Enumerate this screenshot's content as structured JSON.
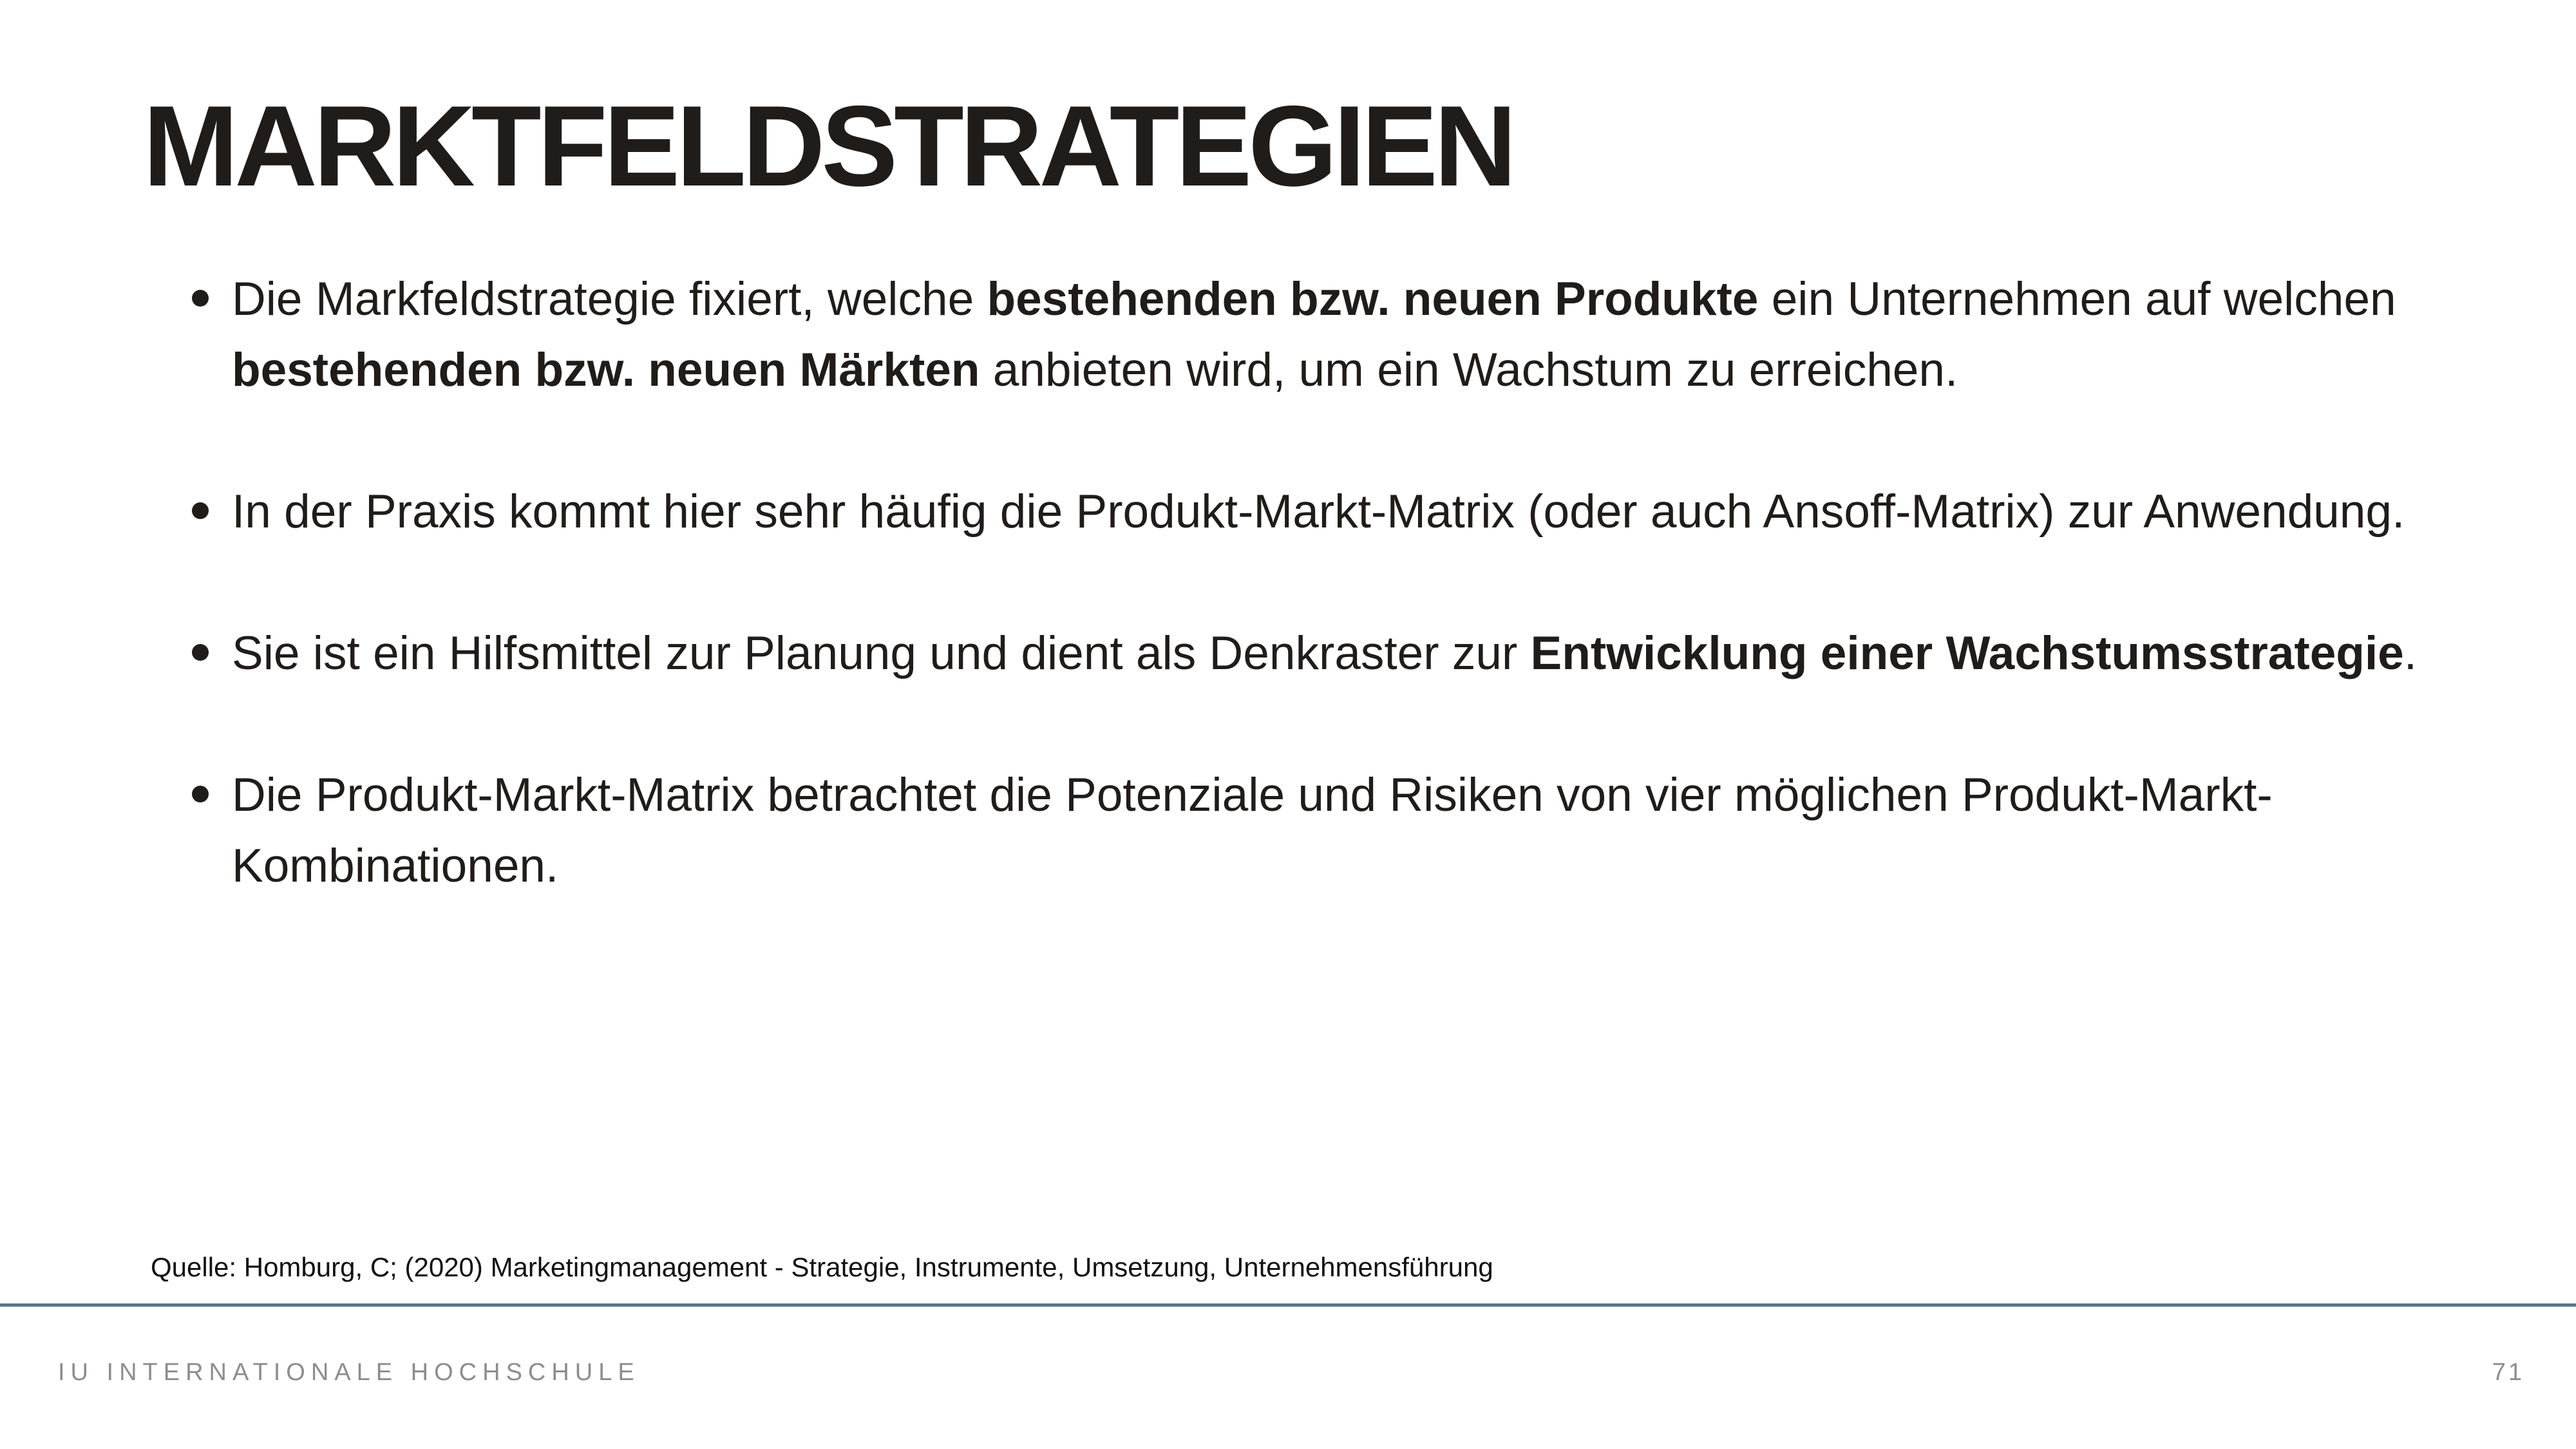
{
  "slide": {
    "title": "MARKTFELDSTRATEGIEN"
  },
  "bullets": [
    {
      "pre": "Die Markfeldstrategie fixiert, welche ",
      "bold1": "bestehenden bzw. neuen Produkte",
      "mid": " ein Unternehmen auf welchen ",
      "bold2": "bestehenden bzw. neuen Märkten",
      "post": " anbieten wird, um ein Wachstum zu erreichen."
    },
    {
      "text": "In der Praxis kommt hier sehr häufig die Produkt-Markt-Matrix (oder auch Ansoff-Matrix) zur Anwendung."
    },
    {
      "pre": "Sie ist ein Hilfsmittel zur Planung und dient als Denkraster zur ",
      "bold": "Entwicklung einer Wachstumsstrategie",
      "post": "."
    },
    {
      "text": "Die Produkt-Markt-Matrix betrachtet die Potenziale und Risiken von vier möglichen Produkt-Markt-Kombinationen."
    }
  ],
  "source": {
    "text": "Quelle: Homburg, C; (2020) Marketingmanagement - Strategie, Instrumente, Umsetzung, Unternehmensführung"
  },
  "footer": {
    "brand": "IU INTERNATIONALE HOCHSCHULE",
    "page_number": "71"
  },
  "colors": {
    "text": "#1f1c1a",
    "footer_rule": "#5b7590",
    "footer_text": "#8d8d8d"
  }
}
